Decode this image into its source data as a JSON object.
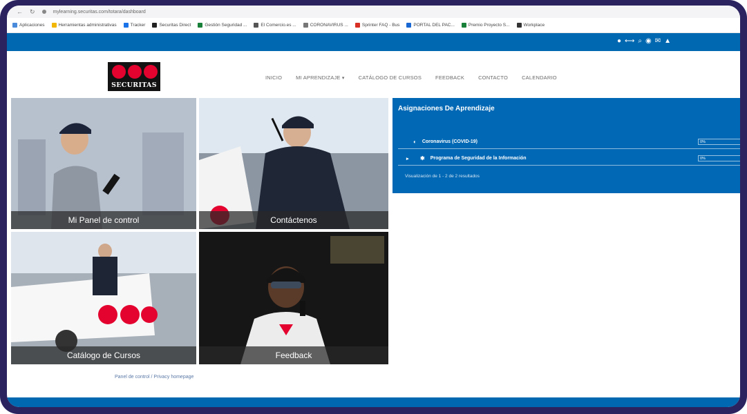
{
  "browser": {
    "url": "mylearning.securitas.com/totara/dashboard",
    "bookmarks": [
      {
        "label": "Aplicaciones",
        "color": "#4a8bdb"
      },
      {
        "label": "Herramientas administrativas",
        "color": "#f2b705"
      },
      {
        "label": "Tracker",
        "color": "#1a73e8"
      },
      {
        "label": "Securitas Direct",
        "color": "#222222"
      },
      {
        "label": "Gestión Seguridad ...",
        "color": "#188038"
      },
      {
        "label": "El Comercio.es ...",
        "color": "#555555"
      },
      {
        "label": "CORONAVIRUS ...",
        "color": "#777777"
      },
      {
        "label": "Sprinter FAQ - Bus",
        "color": "#d93025"
      },
      {
        "label": "PORTAL DEL PAC...",
        "color": "#1967d2"
      },
      {
        "label": "Premio Proyecto S...",
        "color": "#188038"
      },
      {
        "label": "Workplace",
        "color": "#333333"
      }
    ]
  },
  "logo": {
    "name": "SECURITAS",
    "color": "#e4032e"
  },
  "nav": {
    "items": [
      "INICIO",
      "MI APRENDIZAJE",
      "CATÁLOGO DE CURSOS",
      "FEEDBACK",
      "CONTACTO",
      "CALENDARIO"
    ]
  },
  "tiles": [
    {
      "caption": "Mi Panel de control"
    },
    {
      "caption": "Contáctenos"
    },
    {
      "caption": "Catálogo de Cursos"
    },
    {
      "caption": "Feedback"
    }
  ],
  "panel": {
    "title": "Asignaciones De Aprendizaje",
    "rows": [
      {
        "label": "Coronavirus (COVID-19)",
        "progress": "0%"
      },
      {
        "label": "Programa de Seguridad de la Información",
        "progress": "0%"
      }
    ],
    "footer": "Visualización de 1 - 2 de 2 resultados"
  },
  "breadcrumb": "Panel de control / Privacy homepage",
  "colors": {
    "brand_blue": "#0067b1",
    "frame": "#2b2360"
  }
}
